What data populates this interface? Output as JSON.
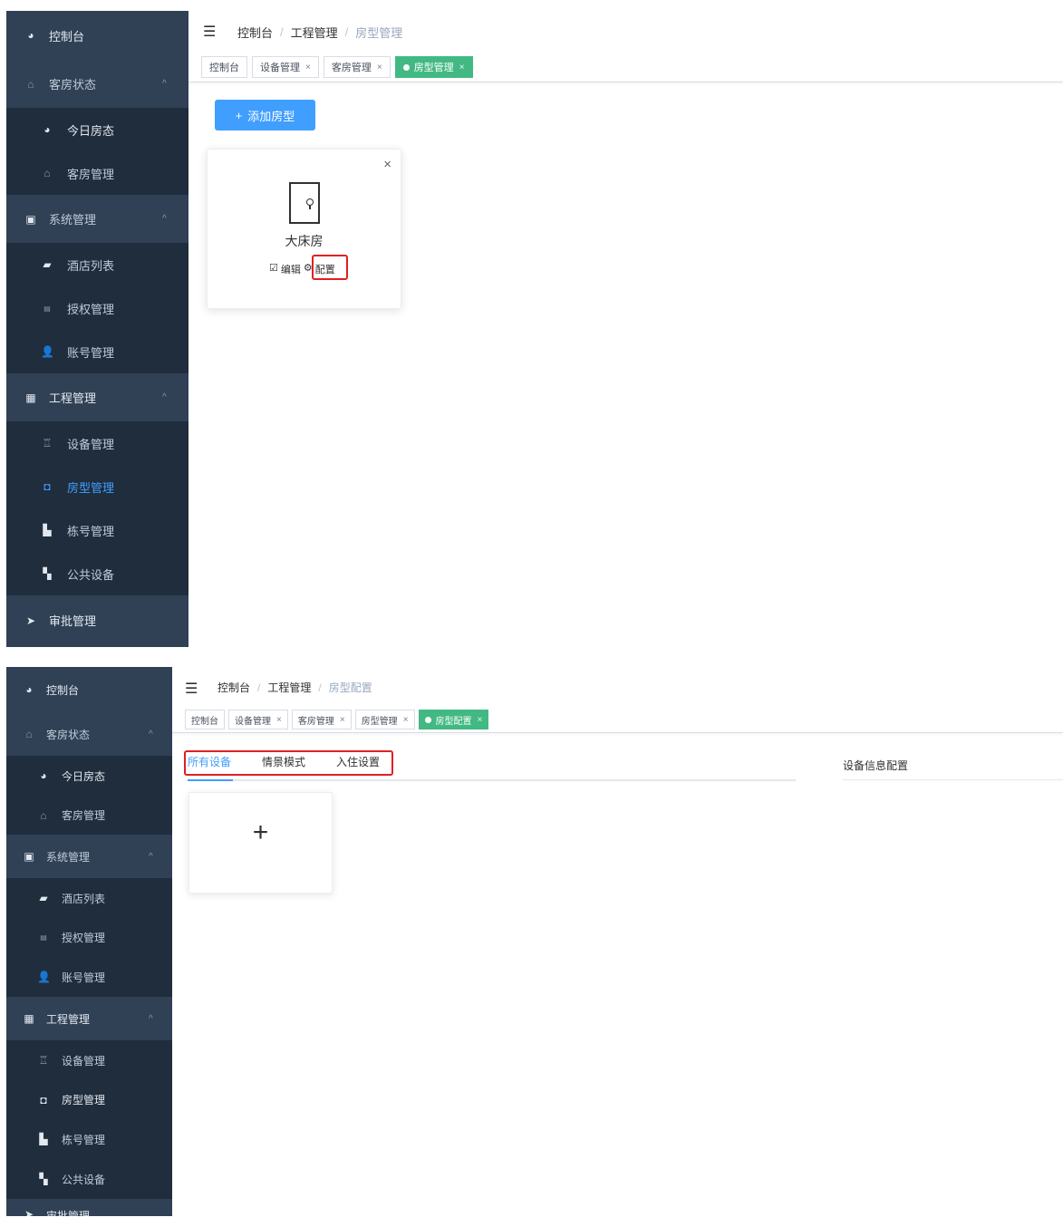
{
  "panel1": {
    "sidebar": {
      "items": [
        {
          "label": "控制台",
          "icon": "dashboard-icon"
        },
        {
          "label": "客房状态",
          "icon": "home-icon",
          "chevron": "^"
        },
        {
          "label": "今日房态",
          "icon": "dashboard-icon"
        },
        {
          "label": "客房管理",
          "icon": "home-icon"
        },
        {
          "label": "系统管理",
          "icon": "user-badge-icon",
          "chevron": "^"
        },
        {
          "label": "酒店列表",
          "icon": "folder-icon"
        },
        {
          "label": "授权管理",
          "icon": "api-icon"
        },
        {
          "label": "账号管理",
          "icon": "user-icon"
        },
        {
          "label": "工程管理",
          "icon": "building-icon",
          "chevron": "^"
        },
        {
          "label": "设备管理",
          "icon": "device-icon"
        },
        {
          "label": "房型管理",
          "icon": "room-type-icon"
        },
        {
          "label": "栋号管理",
          "icon": "building-number-icon"
        },
        {
          "label": "公共设备",
          "icon": "grid-icon"
        },
        {
          "label": "审批管理",
          "icon": "send-icon"
        }
      ]
    },
    "breadcrumb": [
      "控制台",
      "工程管理",
      "房型管理"
    ],
    "tags": [
      {
        "label": "控制台",
        "closable": false
      },
      {
        "label": "设备管理",
        "closable": true
      },
      {
        "label": "客房管理",
        "closable": true
      },
      {
        "label": "房型管理",
        "closable": true,
        "active": true
      }
    ],
    "add_button": "添加房型",
    "card": {
      "name": "大床房",
      "edit": "编辑",
      "config": "配置"
    }
  },
  "panel2": {
    "breadcrumb": [
      "控制台",
      "工程管理",
      "房型配置"
    ],
    "tags": [
      {
        "label": "控制台",
        "closable": false
      },
      {
        "label": "设备管理",
        "closable": true
      },
      {
        "label": "客房管理",
        "closable": true
      },
      {
        "label": "房型管理",
        "closable": true
      },
      {
        "label": "房型配置",
        "closable": true,
        "active": true
      }
    ],
    "tabs": [
      "所有设备",
      "情景模式",
      "入住设置"
    ],
    "right_title": "设备信息配置",
    "add_symbol": "+"
  },
  "close_glyph": "×",
  "colors": {
    "sidebar": "#304156",
    "submenu": "#1f2d3d",
    "primary": "#409eff",
    "tag_active": "#42b983",
    "highlight": "#e02020"
  }
}
